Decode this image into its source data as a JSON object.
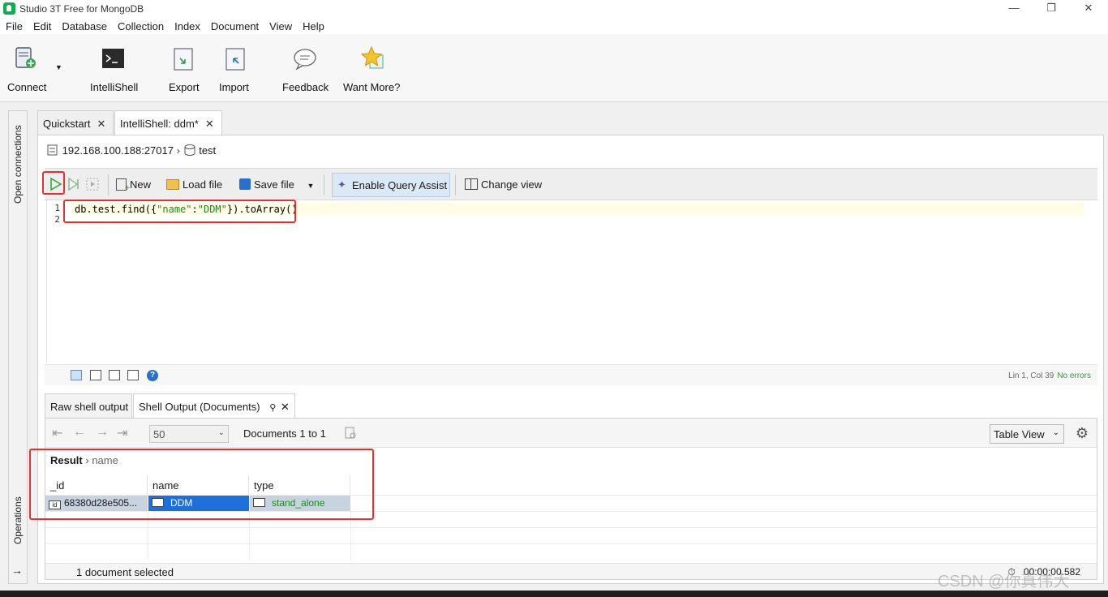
{
  "window": {
    "title": "Studio 3T Free for MongoDB"
  },
  "menu": [
    "File",
    "Edit",
    "Database",
    "Collection",
    "Index",
    "Document",
    "View",
    "Help"
  ],
  "toolbar": {
    "connect": "Connect",
    "intellishell": "IntelliShell",
    "export": "Export",
    "import": "Import",
    "feedback": "Feedback",
    "want_more": "Want More?"
  },
  "left_rail": {
    "top": "Open connections",
    "bottom": "Operations"
  },
  "tabs": [
    {
      "label": "Quickstart"
    },
    {
      "label": "IntelliShell: ddm*"
    }
  ],
  "connection": {
    "host": "192.168.100.188:27017",
    "db": "test"
  },
  "editor_toolbar": {
    "new": "New",
    "load_file": "Load file",
    "save_file": "Save file",
    "query_assist": "Enable Query Assist",
    "change_view": "Change view"
  },
  "editor": {
    "line_numbers": [
      "1",
      "2"
    ],
    "code_prefix": "db.test.find({",
    "code_key": "\"name\"",
    "code_colon": ":",
    "code_val": "\"DDM\"",
    "code_suffix": "}).toArray()"
  },
  "editor_status": {
    "position": "Lin 1, Col 39",
    "errors": "No errors"
  },
  "result_tabs": [
    {
      "label": "Raw shell output"
    },
    {
      "label": "Shell Output (Documents)"
    }
  ],
  "pager": {
    "page_size": "50",
    "doc_count": "Documents 1 to 1",
    "view": "Table View"
  },
  "breadcrumb": {
    "root": "Result",
    "field": "name"
  },
  "table": {
    "columns": [
      "_id",
      "name",
      "type"
    ],
    "row": {
      "id": "68380d28e505...",
      "name": "DDM",
      "type": "stand_alone"
    }
  },
  "selection_status": "1 document selected",
  "elapsed": "00:00:00.582",
  "watermark": "CSDN @你真伟大",
  "colors": {
    "accent_green": "#13aa52",
    "annotation_red": "#e53030",
    "selected_cell": "#1e6fd9"
  }
}
